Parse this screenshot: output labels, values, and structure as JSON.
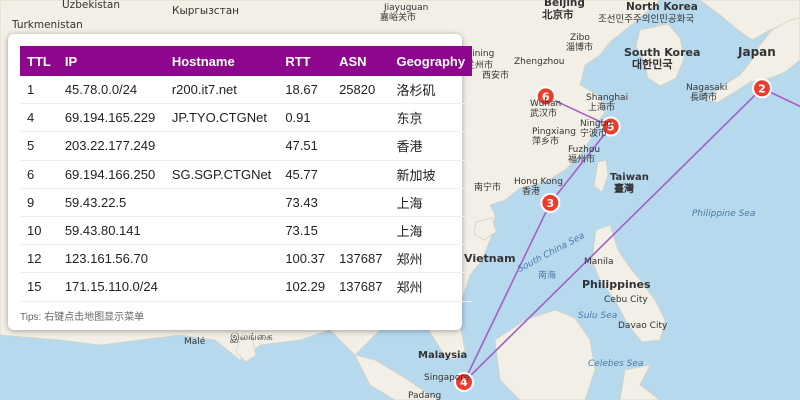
{
  "map": {
    "labels": {
      "uzbekistan": "Uzbekistan",
      "turkmenistan": "Turkmenistan",
      "kyrgyzstan": "Кыргызстан",
      "jiayuguan": "Jiayuguan",
      "jiayuguan_cn": "嘉峪关市",
      "beijing": "Beijing",
      "beijing_cn": "北京市",
      "north_korea": "North Korea",
      "north_korea_local": "조선민주주의인민공화국",
      "south_korea": "South Korea",
      "south_korea_local": "대한민국",
      "japan": "Japan",
      "nagasaki": "Nagasaki",
      "nagasaki_jp": "長崎市",
      "xining": "Xining",
      "zibo": "Zibo",
      "zibo_cn": "淄博市",
      "zhengzhou": "Zhengzhou",
      "lanzhou": "兰州市",
      "xian": "西安市",
      "shanghai": "Shanghai",
      "shanghai_cn": "上海市",
      "wuhan": "Wuhan",
      "wuhan_cn": "武汉市",
      "ningbo": "Ningbo",
      "ningbo_cn": "宁波市",
      "pingxiang": "Pingxiang",
      "pingxiang_cn": "萍乡市",
      "fuzhou": "Fuzhou",
      "fuzhou_cn": "福州市",
      "taiwan": "Taiwan",
      "taiwan_cn": "臺灣",
      "hong_kong": "Hong Kong",
      "hong_kong_cn": "香港",
      "nanning": "南宁市",
      "vietnam": "Vietnam",
      "south_china_sea": "South China Sea",
      "south_china_sea_cn": "南海",
      "philippine_sea": "Philippine Sea",
      "manila": "Manila",
      "philippines": "Philippines",
      "cebu": "Cebu City",
      "sulu_sea": "Sulu Sea",
      "davao": "Davao City",
      "celebes_sea": "Celebes Sea",
      "sri_lanka": "இலங்கை",
      "male": "Malé",
      "malaysia": "Malaysia",
      "singapore": "Singapore",
      "padang": "Padang"
    },
    "markers": [
      {
        "label": "2",
        "lon": 139.7,
        "lat": 35.7
      },
      {
        "label": "3",
        "lon": 114.2,
        "lat": 22.3
      },
      {
        "label": "4",
        "lon": 103.8,
        "lat": 1.35
      },
      {
        "label": "5",
        "lon": 121.47,
        "lat": 31.23
      },
      {
        "label": "6",
        "lon": 113.65,
        "lat": 34.75
      }
    ],
    "colors": {
      "water": "#b6d9ee",
      "land": "#f2efe6",
      "route": "#a45fc4",
      "marker": "#ef3b2c"
    }
  },
  "panel": {
    "columns": [
      "TTL",
      "IP",
      "Hostname",
      "RTT",
      "ASN",
      "Geography"
    ],
    "rows": [
      [
        "1",
        "45.78.0.0/24",
        "r200.it7.net",
        "18.67",
        "25820",
        "洛杉矶"
      ],
      [
        "4",
        "69.194.165.229",
        "JP.TYO.CTGNet",
        "0.91",
        "",
        "东京"
      ],
      [
        "5",
        "203.22.177.249",
        "",
        "47.51",
        "",
        "香港"
      ],
      [
        "6",
        "69.194.166.250",
        "SG.SGP.CTGNet",
        "45.77",
        "",
        "新加坡"
      ],
      [
        "9",
        "59.43.22.5",
        "",
        "73.43",
        "",
        "上海"
      ],
      [
        "10",
        "59.43.80.141",
        "",
        "73.15",
        "",
        "上海"
      ],
      [
        "12",
        "123.161.56.70",
        "",
        "100.37",
        "137687",
        "郑州"
      ],
      [
        "15",
        "171.15.110.0/24",
        "",
        "102.29",
        "137687",
        "郑州"
      ]
    ],
    "tips": "Tips: 右键点击地图显示菜单",
    "header_color": "#8e058e"
  }
}
